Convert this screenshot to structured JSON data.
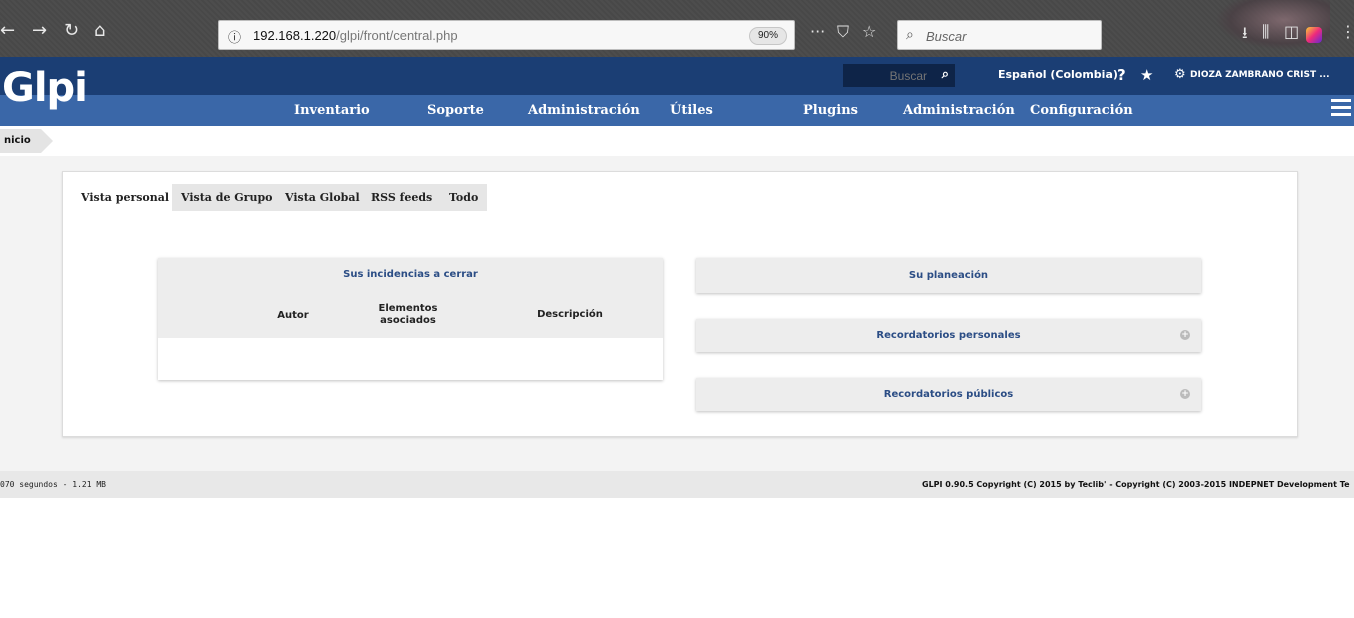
{
  "browser": {
    "back_icon": "back-arrow-icon",
    "back_glyph": "←",
    "forward_glyph": "→",
    "reload_glyph": "↻",
    "home_glyph": "⌂",
    "info_glyph": "ⓘ",
    "url_host": "192.168.1.220",
    "url_path": "/glpi/front/central.php",
    "zoom": "90%",
    "more_glyph": "···",
    "pocket_glyph": "⛉",
    "star_glyph": "☆",
    "search_glyph": "🔍",
    "search_placeholder": "Buscar",
    "download_glyph": "⭳",
    "library_glyph": "⫼",
    "sidebar_glyph": "◫",
    "menu_glyph": "⋮"
  },
  "header": {
    "logo": "Glpi",
    "search_placeholder": "Buscar",
    "search_glyph": "🔍",
    "language": "Español (Colombia)",
    "help_glyph": "?",
    "favorites_glyph": "★",
    "user_glyph": "⚙",
    "user_name": "DIOZA ZAMBRANO CRIST ..."
  },
  "menu": {
    "items": [
      "Inventario",
      "Soporte",
      "Administración",
      "Útiles",
      "Plugins",
      "Administración",
      "Configuración"
    ]
  },
  "breadcrumb": {
    "label": "nicio"
  },
  "tabs": [
    "Vista personal",
    "Vista de Grupo",
    "Vista Global",
    "RSS feeds",
    "Todo"
  ],
  "incidencias": {
    "title": "Sus incidencias a cerrar",
    "columns": [
      "Autor",
      "Elementos asociados",
      "Descripción"
    ]
  },
  "right_boxes": {
    "planeacion": "Su planeación",
    "recordatorios_personales": "Recordatorios personales",
    "recordatorios_publicos": "Recordatorios públicos",
    "plus_glyph": "+"
  },
  "footer": {
    "left": "070 segundos - 1.21 MB",
    "right": "GLPI 0.90.5 Copyright (C) 2015 by Teclib' - Copyright (C) 2003-2015 INDEPNET Development Te"
  }
}
